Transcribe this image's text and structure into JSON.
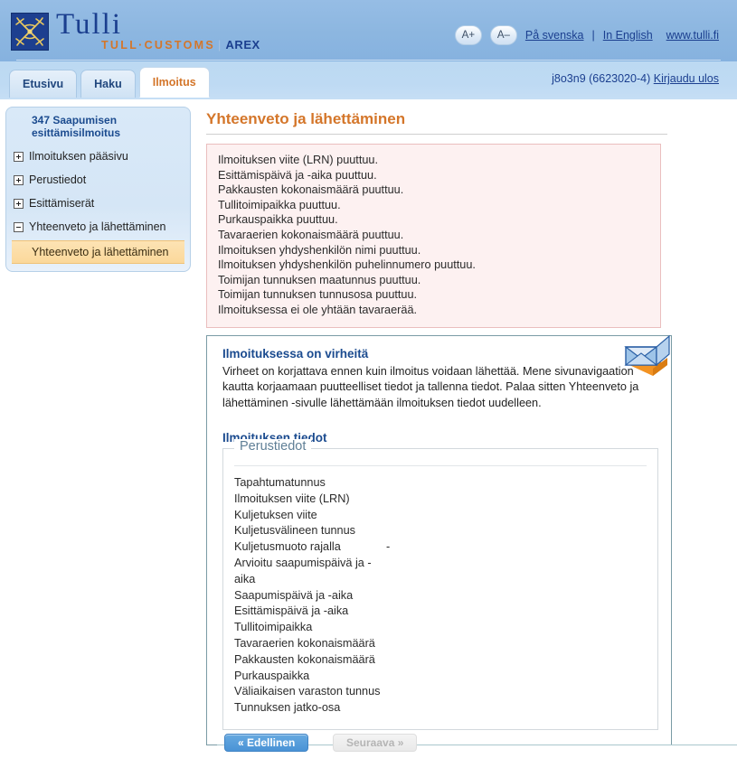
{
  "header": {
    "logo": {
      "brand": "Tulli",
      "subtitle": "TULL·CUSTOMS",
      "system": "AREX",
      "icon": "customs-caduceus-emblem"
    },
    "font_increase_label": "A+",
    "font_decrease_label": "A–",
    "links": [
      {
        "label": "På svenska"
      },
      {
        "label": "In English"
      },
      {
        "label": "www.tulli.fi"
      }
    ],
    "separator": "|"
  },
  "tabs": [
    {
      "label": "Etusivu",
      "active": false
    },
    {
      "label": "Haku",
      "active": false
    },
    {
      "label": "Ilmoitus",
      "active": true
    }
  ],
  "user": {
    "account": "j8o3n9 (6623020-4)",
    "logout_label": "Kirjaudu ulos"
  },
  "sidebar": {
    "title": "347 Saapumisen esittämisilmoitus",
    "items": [
      {
        "label": "Ilmoituksen pääsivu",
        "state": "collapsed"
      },
      {
        "label": "Perustiedot",
        "state": "collapsed"
      },
      {
        "label": "Esittämiserät",
        "state": "collapsed"
      },
      {
        "label": "Yhteenveto ja lähettäminen",
        "state": "expanded"
      }
    ],
    "selected_subitem": "Yhteenveto ja lähettäminen"
  },
  "main": {
    "page_title": "Yhteenveto ja lähettäminen",
    "errors": [
      "Ilmoituksen viite (LRN) puuttuu.",
      "Esittämispäivä ja -aika puuttuu.",
      "Pakkausten kokonaismäärä puuttuu.",
      "Tullitoimipaikka puuttuu.",
      "Purkauspaikka puuttuu.",
      "Tavaraerien kokonaismäärä puuttuu.",
      "Ilmoituksen yhdyshenkilön nimi puuttuu.",
      "Ilmoituksen yhdyshenkilön puhelinnumero puuttuu.",
      "Toimijan tunnuksen maatunnus puuttuu.",
      "Toimijan tunnuksen tunnusosa puuttuu.",
      "Ilmoituksessa ei ole yhtään tavaraerää."
    ],
    "notice": {
      "title": "Ilmoituksessa on virheitä",
      "text": "Virheet on korjattava ennen kuin ilmoitus voidaan lähettää. Mene sivunavigaation kautta korjaamaan puutteelliset tiedot ja tallenna tiedot. Palaa sitten Yhteenveto ja lähettäminen -sivulle lähettämään ilmoituksen tiedot uudelleen.",
      "icon": "envelope-send-icon"
    },
    "details_title": "Ilmoituksen tiedot",
    "fieldset": {
      "legend": "Perustiedot",
      "fields": [
        {
          "label": "Tapahtumatunnus",
          "value": ""
        },
        {
          "label": "Ilmoituksen viite (LRN)",
          "value": ""
        },
        {
          "label": "Kuljetuksen viite",
          "value": ""
        },
        {
          "label": "Kuljetusvälineen tunnus",
          "value": ""
        },
        {
          "label": "Kuljetusmuoto rajalla",
          "value": "-"
        },
        {
          "label": "Arvioitu saapumispäivä ja -aika",
          "value": ""
        },
        {
          "label": "Saapumispäivä ja -aika",
          "value": ""
        },
        {
          "label": "Esittämispäivä ja -aika",
          "value": ""
        },
        {
          "label": "Tullitoimipaikka",
          "value": ""
        },
        {
          "label": "Tavaraerien kokonaismäärä",
          "value": ""
        },
        {
          "label": "Pakkausten kokonaismäärä",
          "value": ""
        },
        {
          "label": "Purkauspaikka",
          "value": ""
        },
        {
          "label": "Väliaikaisen varaston tunnus",
          "value": ""
        },
        {
          "label": "Tunnuksen jatko-osa",
          "value": ""
        }
      ]
    }
  },
  "footer_nav": {
    "prev_label": "«  Edellinen",
    "next_label": "Seuraava  »",
    "next_disabled": true
  },
  "colors": {
    "header_blue": "#8cb6e0",
    "header_light_blue": "#bcd9f2",
    "brand_blue": "#1b3f8f",
    "accent_orange": "#d4762a",
    "error_bg": "#fdf1f1",
    "error_border": "#eabebe",
    "highlight_orange": "#fbd89a",
    "panel_border": "#7a9ba5",
    "button_blue": "#4a93d6"
  }
}
